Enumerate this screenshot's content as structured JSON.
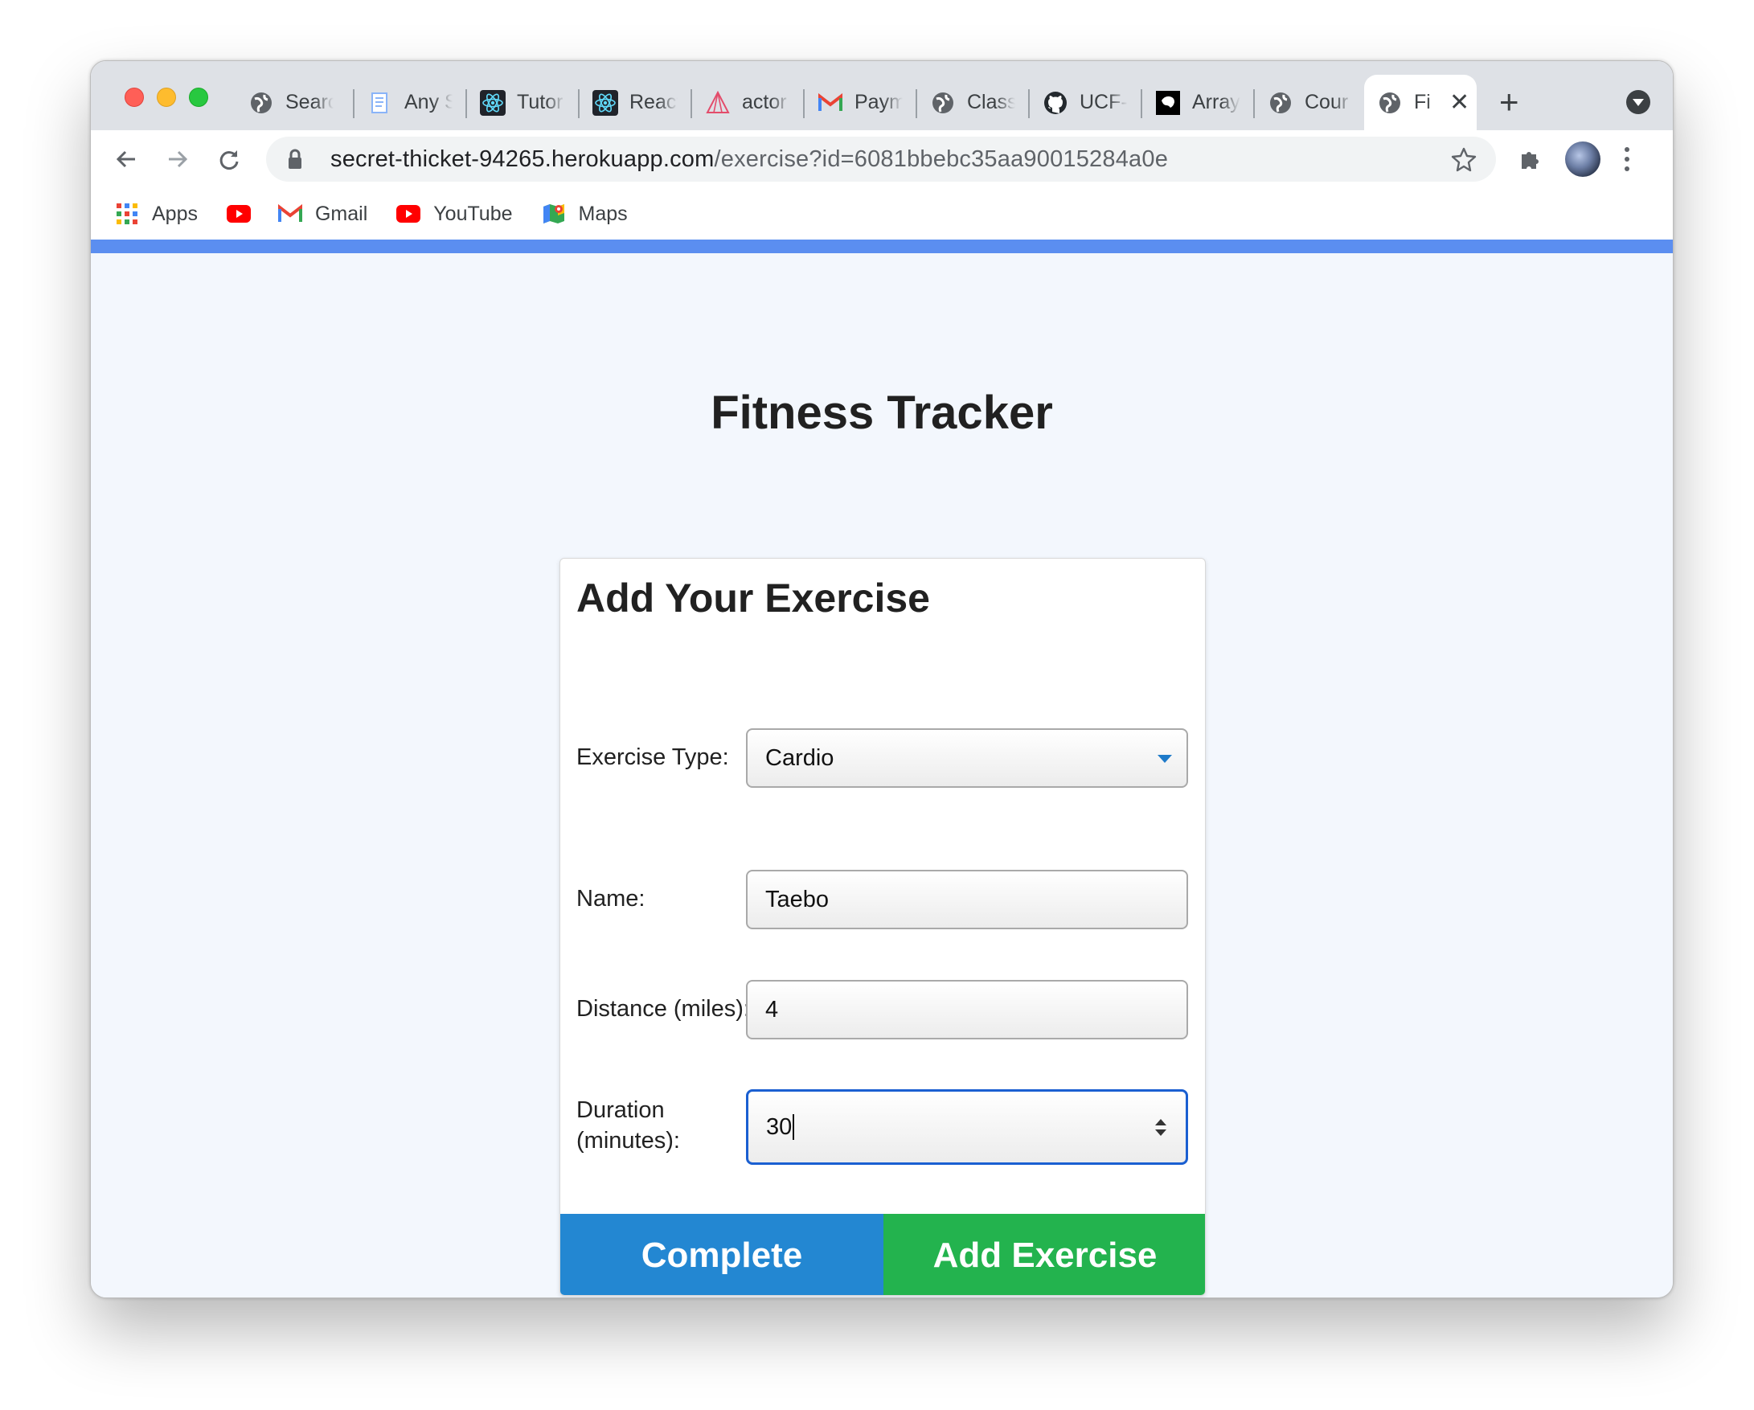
{
  "browser": {
    "tabs": [
      {
        "label": "Searc",
        "icon": "globe-icon"
      },
      {
        "label": "Any S",
        "icon": "document-icon"
      },
      {
        "label": "Tutor",
        "icon": "react-icon"
      },
      {
        "label": "React",
        "icon": "react-icon"
      },
      {
        "label": "actor",
        "icon": "prism-icon"
      },
      {
        "label": "Paym",
        "icon": "gmail-icon"
      },
      {
        "label": "Class",
        "icon": "globe-icon"
      },
      {
        "label": "UCF-",
        "icon": "github-icon"
      },
      {
        "label": "Array",
        "icon": "codepen-icon"
      },
      {
        "label": "Cour",
        "icon": "globe-icon"
      }
    ],
    "active_tab": {
      "label": "Fi",
      "icon": "globe-icon",
      "close": "✕"
    },
    "new_tab": "+",
    "url_host": "secret-thicket-94265.herokuapp.com",
    "url_path": "/exercise?id=6081bbebc35aa90015284a0e",
    "bookmarks": [
      {
        "label": "Apps",
        "icon": "apps-grid-icon"
      },
      {
        "label": "",
        "icon": "youtube-icon"
      },
      {
        "label": "Gmail",
        "icon": "gmail-icon"
      },
      {
        "label": "YouTube",
        "icon": "youtube-icon"
      },
      {
        "label": "Maps",
        "icon": "maps-icon"
      }
    ],
    "accent_color": "#5b8ef0"
  },
  "page": {
    "title": "Fitness Tracker",
    "card_title": "Add Your Exercise",
    "fields": {
      "type_label": "Exercise Type:",
      "type_value": "Cardio",
      "name_label": "Name:",
      "name_value": "Taebo",
      "distance_label": "Distance (miles):",
      "distance_value": "4",
      "duration_label_line1": "Duration",
      "duration_label_line2": "(minutes):",
      "duration_value": "30"
    },
    "buttons": {
      "complete": "Complete",
      "add": "Add Exercise"
    },
    "colors": {
      "complete_button": "#2387d2",
      "add_button": "#23b34e",
      "focus_border": "#1a5fd1"
    }
  }
}
